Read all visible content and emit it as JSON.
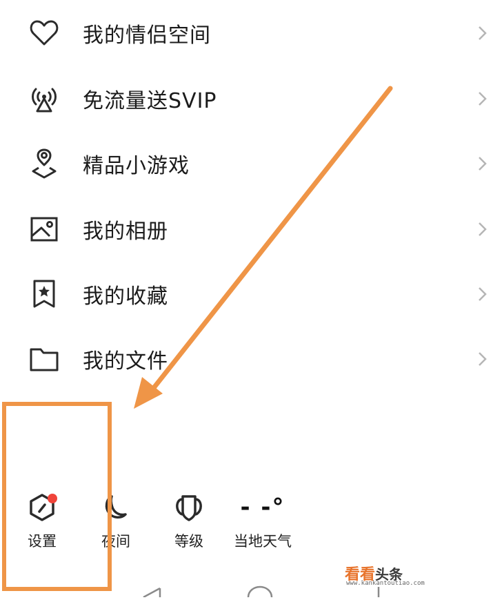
{
  "menu": {
    "items": [
      {
        "label": "我的情侣空间",
        "icon": "heart-icon"
      },
      {
        "label": "免流量送SVIP",
        "icon": "signal-tower-icon"
      },
      {
        "label": "精品小游戏",
        "icon": "game-location-icon"
      },
      {
        "label": "我的相册",
        "icon": "photo-album-icon"
      },
      {
        "label": "我的收藏",
        "icon": "bookmark-star-icon"
      },
      {
        "label": "我的文件",
        "icon": "folder-icon"
      }
    ]
  },
  "bottom_bar": {
    "settings": {
      "label": "设置",
      "icon": "settings-hexagon-icon",
      "badge_color": "#f0443a"
    },
    "night": {
      "label": "夜间",
      "icon": "moon-icon"
    },
    "level": {
      "label": "等级",
      "icon": "level-badge-icon"
    },
    "weather": {
      "label": "当地天气",
      "value": "- -°"
    }
  },
  "watermark": {
    "main": "看看",
    "sub": "头条",
    "url": "www.kankantoutiao.com"
  },
  "colors": {
    "annotation": "#ef9547",
    "icon_stroke": "#2b2b2b",
    "chevron": "#b5b5b5"
  }
}
